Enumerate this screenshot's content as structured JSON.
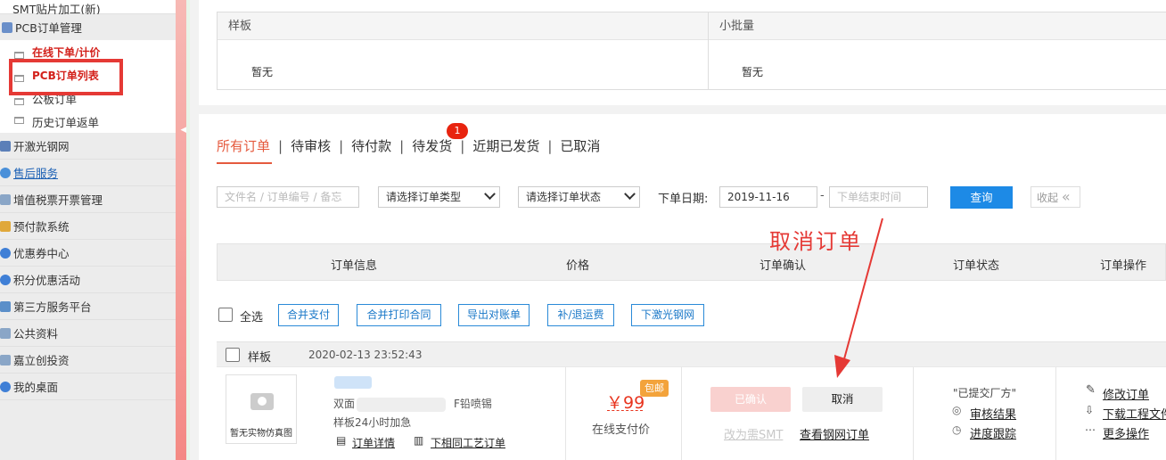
{
  "sidebar": {
    "top_cut_item": "SMT贴片加工(新)",
    "pcb_menu": "PCB订单管理",
    "sub_items": [
      "在线下单/计价",
      "PCB订单列表",
      "公板订单",
      "历史订单返单"
    ],
    "menu_items": [
      "开激光钢网",
      "售后服务",
      "增值税票开票管理",
      "预付款系统",
      "优惠券中心",
      "积分优惠活动",
      "第三方服务平台",
      "公共资料",
      "嘉立创投资",
      "我的桌面"
    ]
  },
  "summary": {
    "col1_header": "样板",
    "col1_value": "暂无",
    "col2_header": "小批量",
    "col2_value": "暂无"
  },
  "tabs": {
    "all": "所有订单",
    "pending_review": "待审核",
    "pending_payment": "待付款",
    "pending_shipping": "待发货",
    "recent_shipped": "近期已发货",
    "cancelled": "已取消",
    "separator": "|",
    "badge_count": "1"
  },
  "filters": {
    "search_placeholder": "文件名 / 订单编号 / 备忘",
    "order_type": "请选择订单类型",
    "order_status": "请选择订单状态",
    "date_label": "下单日期:",
    "date_start": "2019-11-16",
    "date_dash": "-",
    "date_end_placeholder": "下单结束时间",
    "query_button": "查询",
    "collapse_button": "收起",
    "collapse_icon": "«"
  },
  "annotation": {
    "text": "取消订单",
    "color": "#e53935"
  },
  "table_header": {
    "order_info": "订单信息",
    "price": "价格",
    "confirm": "订单确认",
    "status": "订单状态",
    "operation": "订单操作"
  },
  "bulk": {
    "select_all": "全选",
    "buttons": [
      "合并支付",
      "合并打印合同",
      "导出对账单",
      "补/退运费",
      "下激光钢网"
    ]
  },
  "order": {
    "type": "样板",
    "datetime": "2020-02-13 23:52:43",
    "thumb_text": "暂无实物仿真图",
    "desc_prefix": "双面",
    "desc_suffix": "F铅喷锡",
    "speed": "样板24小时加急",
    "detail_link": "订单详情",
    "same_process_link": "下相同工艺订单",
    "price": "￥99",
    "pkg_tag": "包邮",
    "price_note": "在线支付价",
    "confirmed_btn": "已确认",
    "cancel_btn": "取消",
    "smt_link": "改为需SMT",
    "stencil_link": "查看钢网订单",
    "status_text": "\"已提交厂方\"",
    "audit_link": "审核结果",
    "progress_link": "进度跟踪",
    "modify_link": "修改订单",
    "download_link": "下载工程文件",
    "more_link": "更多操作"
  },
  "colors": {
    "accent": "#e55a3e",
    "primary_blue": "#1d8ae6",
    "price_red": "#e8351f",
    "highlight_box": "#e53935"
  }
}
